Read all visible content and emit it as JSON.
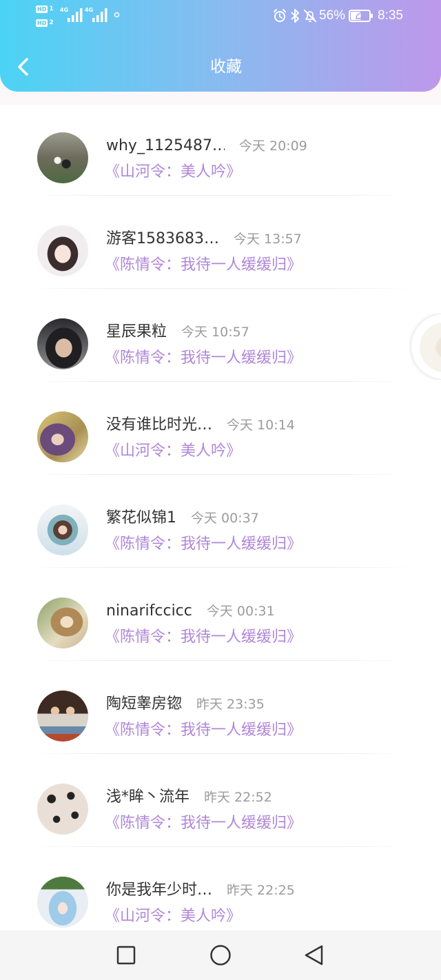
{
  "status_bar": {
    "sim1": {
      "badge": "HD",
      "slot": "1"
    },
    "sim2": {
      "badge": "HD",
      "slot": "2"
    },
    "net1": "4G",
    "net2": "4G",
    "battery_text": "56%",
    "battery_level": 0.56,
    "time": "8:35",
    "icons": [
      "signal-icon",
      "signal-icon",
      "data-activity-icon",
      "alarm-icon",
      "bluetooth-icon",
      "mute-icon",
      "battery-saver-icon"
    ]
  },
  "header": {
    "title": "收藏",
    "back_icon": "chevron-left-icon"
  },
  "favorites": [
    {
      "name": "why_1125487…",
      "time": "今天 20:09",
      "book": "《山河令：美人吟》"
    },
    {
      "name": "游客1583683…",
      "time": "今天 13:57",
      "book": "《陈情令：我待一人缓缓归》"
    },
    {
      "name": "星辰果粒",
      "time": "今天 10:57",
      "book": "《陈情令：我待一人缓缓归》"
    },
    {
      "name": "没有谁比时光…",
      "time": "今天 10:14",
      "book": "《山河令：美人吟》"
    },
    {
      "name": "繁花似锦1",
      "time": "今天 00:37",
      "book": "《陈情令：我待一人缓缓归》"
    },
    {
      "name": "ninarifccicc",
      "time": "今天 00:31",
      "book": "《陈情令：我待一人缓缓归》"
    },
    {
      "name": "陶短睾房锪",
      "time": "昨天 23:35",
      "book": "《陈情令：我待一人缓缓归》"
    },
    {
      "name": "浅*眸丶流年",
      "time": "昨天 22:52",
      "book": "《陈情令：我待一人缓缓归》"
    },
    {
      "name": "你是我年少时…",
      "time": "昨天 22:25",
      "book": "《山河令：美人吟》"
    }
  ],
  "nav_bar": {
    "recent_icon": "square-icon",
    "home_icon": "circle-icon",
    "back_icon": "triangle-back-icon"
  },
  "theme": {
    "header_gradient_start": "#4bd3f5",
    "header_gradient_end": "#be98ea",
    "book_title_color": "#b086d9"
  }
}
